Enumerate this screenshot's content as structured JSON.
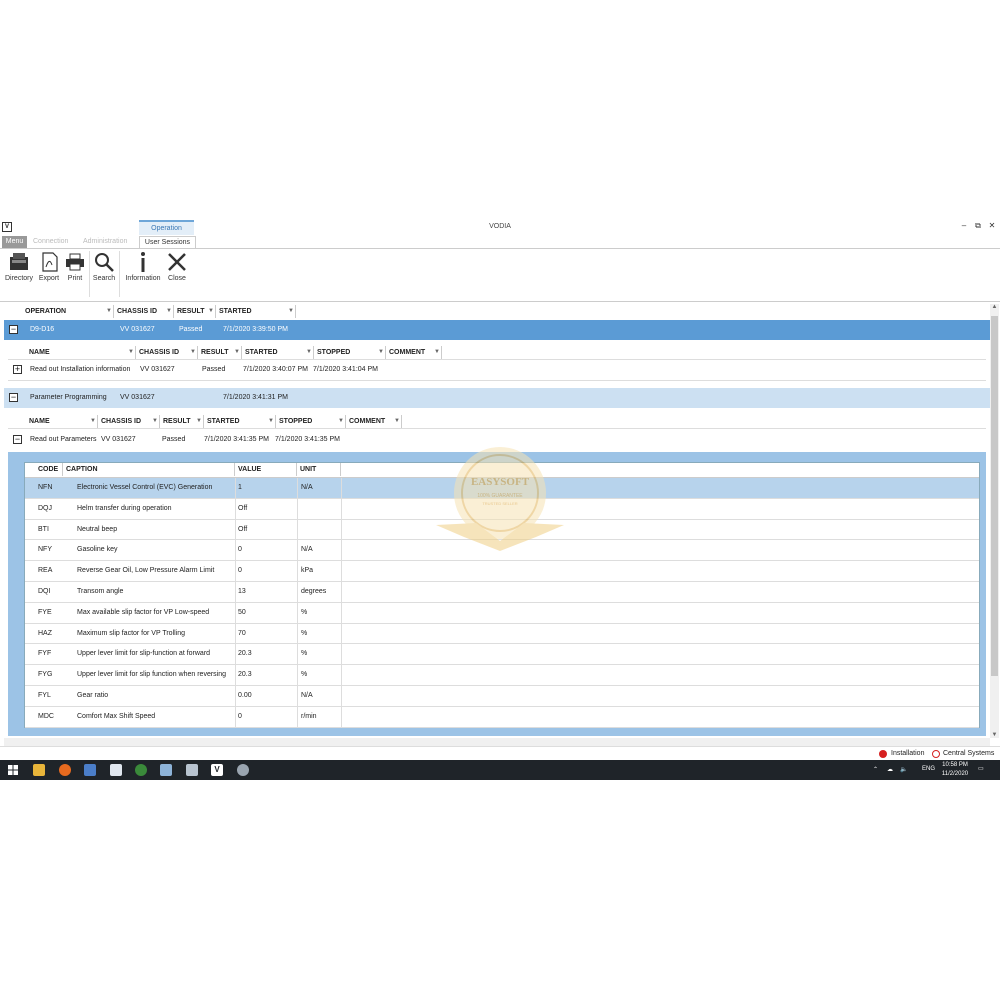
{
  "window": {
    "title": "VODIA",
    "controls": {
      "minimize": "–",
      "restore": "⧉",
      "close": "✕"
    }
  },
  "ribbon": {
    "context_group": "Operation",
    "tabs": {
      "menu": "Menu",
      "connection": "Connection",
      "administration": "Administration",
      "user_sessions": "User Sessions"
    },
    "buttons": {
      "directory": "Directory",
      "export": "Export",
      "print": "Print",
      "search": "Search",
      "information": "Information",
      "close": "Close"
    }
  },
  "operations_grid": {
    "headers": {
      "operation": "OPERATION",
      "chassis_id": "CHASSIS ID",
      "result": "RESULT",
      "started": "STARTED"
    },
    "row": {
      "operation": "D9-D16",
      "chassis": "VV   031627",
      "result": "Passed",
      "started": "7/1/2020 3:39:50 PM"
    }
  },
  "sub_grid_1": {
    "headers": {
      "name": "NAME",
      "chassis_id": "CHASSIS ID",
      "result": "RESULT",
      "started": "STARTED",
      "stopped": "STOPPED",
      "comment": "COMMENT"
    },
    "row": {
      "name": "Read out Installation information",
      "chassis": "VV   031627",
      "result": "Passed",
      "started": "7/1/2020 3:40:07 PM",
      "stopped": "7/1/2020 3:41:04 PM"
    }
  },
  "parameter_group": {
    "name": "Parameter Programming",
    "chassis": "VV   031627",
    "started": "7/1/2020 3:41:31 PM"
  },
  "sub_grid_2": {
    "headers": {
      "name": "NAME",
      "chassis_id": "CHASSIS ID",
      "result": "RESULT",
      "started": "STARTED",
      "stopped": "STOPPED",
      "comment": "COMMENT"
    },
    "row": {
      "name": "Read out Parameters",
      "chassis": "VV   031627",
      "result": "Passed",
      "started": "7/1/2020 3:41:35 PM",
      "stopped": "7/1/2020 3:41:35 PM"
    }
  },
  "parameters_table": {
    "headers": {
      "code": "CODE",
      "caption": "CAPTION",
      "value": "VALUE",
      "unit": "UNIT"
    },
    "rows": [
      {
        "code": "NFN",
        "caption": "Electronic Vessel Control (EVC) Generation",
        "value": "1",
        "unit": "N/A"
      },
      {
        "code": "DQJ",
        "caption": "Helm transfer during operation",
        "value": "Off",
        "unit": ""
      },
      {
        "code": "BTI",
        "caption": "Neutral beep",
        "value": "Off",
        "unit": ""
      },
      {
        "code": "NFY",
        "caption": "Gasoline key",
        "value": "0",
        "unit": "N/A"
      },
      {
        "code": "REA",
        "caption": "Reverse Gear Oil, Low Pressure Alarm Limit",
        "value": "0",
        "unit": "kPa"
      },
      {
        "code": "DQI",
        "caption": "Transom angle",
        "value": "13",
        "unit": "degrees"
      },
      {
        "code": "FYE",
        "caption": "Max available slip factor for VP Low-speed",
        "value": "50",
        "unit": "%"
      },
      {
        "code": "HAZ",
        "caption": "Maximum slip factor for VP Trolling",
        "value": "70",
        "unit": "%"
      },
      {
        "code": "FYF",
        "caption": "Upper lever limit for slip-function at forward",
        "value": "20.3",
        "unit": "%"
      },
      {
        "code": "FYG",
        "caption": "Upper lever limit for slip function when reversing",
        "value": "20.3",
        "unit": "%"
      },
      {
        "code": "FYL",
        "caption": "Gear ratio",
        "value": "0.00",
        "unit": "N/A"
      },
      {
        "code": "MDC",
        "caption": "Comfort Max Shift Speed",
        "value": "0",
        "unit": "r/min"
      }
    ]
  },
  "status_bar": {
    "installation": "Installation",
    "central_systems": "Central Systems"
  },
  "taskbar": {
    "lang": "ENG",
    "time": "10:58 PM",
    "date": "11/2/2020"
  },
  "watermark": {
    "brand": "EASYSOFT",
    "line1": "100% GUARANTEE",
    "line2": "TRUSTED SELLER"
  },
  "colors": {
    "selected_row": "#5b9bd5",
    "group_row": "#cce0f2",
    "nested_panel": "#9cc3e6",
    "param_selected": "#b7d3ec"
  }
}
